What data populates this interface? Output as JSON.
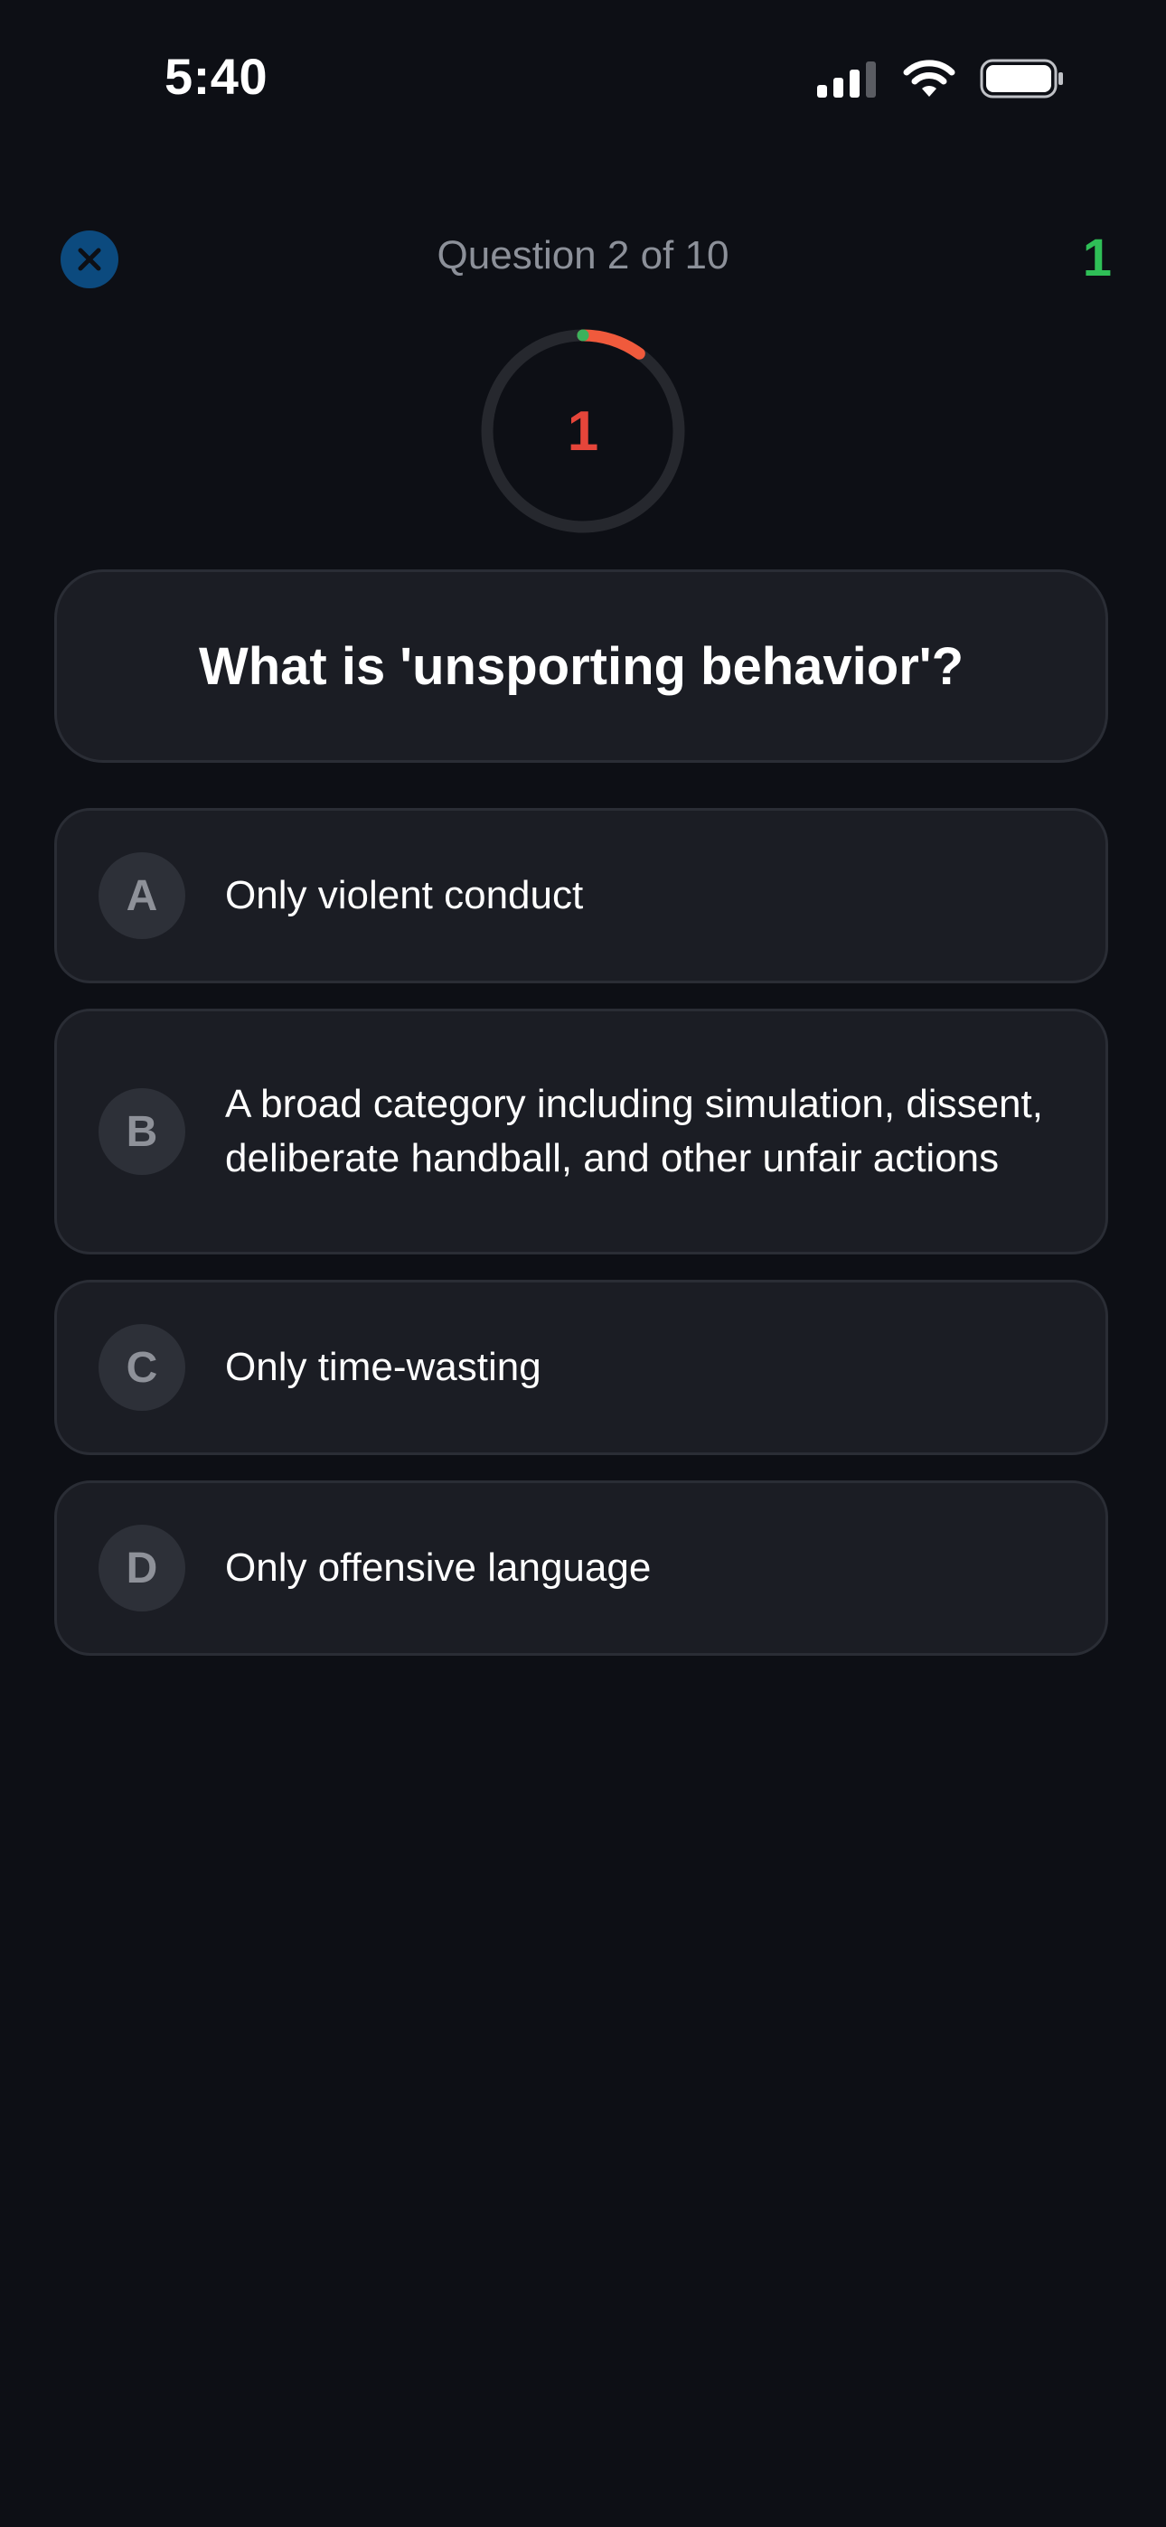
{
  "status_bar": {
    "time": "5:40",
    "icons": [
      "signal-icon",
      "wifi-icon",
      "battery-icon"
    ]
  },
  "header": {
    "close_icon": "close-icon",
    "progress_label": "Question 2 of 10",
    "score": "1"
  },
  "timer": {
    "value": "1",
    "remaining_fraction": 0.1
  },
  "question": {
    "text": "What is 'unsporting behavior'?"
  },
  "answers": [
    {
      "letter": "A",
      "text": "Only violent conduct"
    },
    {
      "letter": "B",
      "text": "A broad category including simulation, dissent, deliberate handball, and other unfair actions"
    },
    {
      "letter": "C",
      "text": "Only time-wasting"
    },
    {
      "letter": "D",
      "text": "Only offensive language"
    }
  ],
  "colors": {
    "background": "#0d0f15",
    "card": "#1b1d24",
    "score_green": "#2fbf57",
    "timer_red": "#e5453a",
    "close_blue": "#0c4a7e"
  }
}
